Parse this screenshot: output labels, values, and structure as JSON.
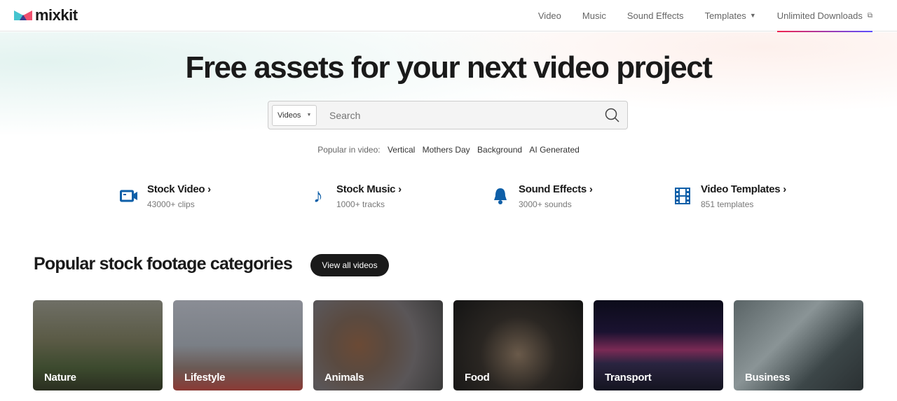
{
  "brand": {
    "name": "mixkit"
  },
  "nav": [
    {
      "label": "Video"
    },
    {
      "label": "Music"
    },
    {
      "label": "Sound Effects"
    },
    {
      "label": "Templates"
    },
    {
      "label": "Unlimited Downloads"
    }
  ],
  "hero": {
    "title": "Free assets for your next video project"
  },
  "search": {
    "type": "Videos",
    "placeholder": "Search"
  },
  "popular": {
    "label": "Popular in video:",
    "tags": [
      "Vertical",
      "Mothers Day",
      "Background",
      "AI Generated"
    ]
  },
  "features": [
    {
      "title": "Stock Video",
      "sub": "43000+ clips",
      "icon": "video-camera-icon"
    },
    {
      "title": "Stock Music",
      "sub": "1000+ tracks",
      "icon": "music-note-icon"
    },
    {
      "title": "Sound Effects",
      "sub": "3000+ sounds",
      "icon": "bell-icon"
    },
    {
      "title": "Video Templates",
      "sub": "851 templates",
      "icon": "film-icon"
    }
  ],
  "categories": {
    "title": "Popular stock footage categories",
    "button": "View all videos",
    "items": [
      {
        "label": "Nature"
      },
      {
        "label": "Lifestyle"
      },
      {
        "label": "Animals"
      },
      {
        "label": "Food"
      },
      {
        "label": "Transport"
      },
      {
        "label": "Business"
      }
    ]
  },
  "colors": {
    "accent": "#0e5fa8",
    "dark": "#1a1a1a"
  }
}
